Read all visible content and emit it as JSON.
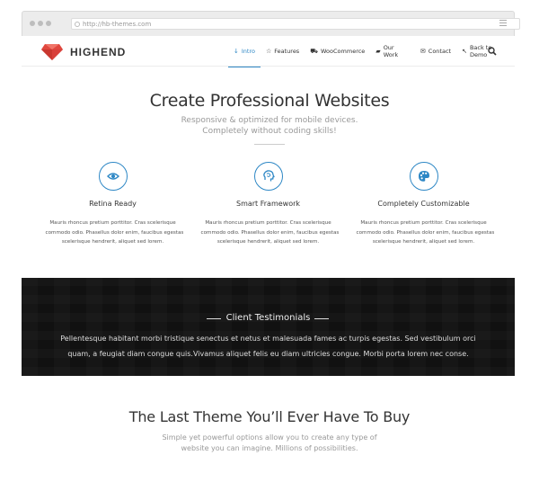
{
  "browser": {
    "url": "http://hb-themes.com"
  },
  "header": {
    "logo_text": "HIGHEND",
    "nav": [
      {
        "label": "Intro",
        "icon": "arrow-down-icon",
        "glyph": "↓",
        "active": true
      },
      {
        "label": "Features",
        "icon": "star-icon",
        "glyph": "☆",
        "active": false
      },
      {
        "label": "WooCommerce",
        "icon": "cart-icon",
        "glyph": "⛟",
        "active": false
      },
      {
        "label": "Our Work",
        "icon": "briefcase-icon",
        "glyph": "▰",
        "active": false
      },
      {
        "label": "Contact",
        "icon": "envelope-icon",
        "glyph": "✉",
        "active": false
      },
      {
        "label": "Back to Demo",
        "icon": "cursor-icon",
        "glyph": "↖",
        "active": false
      }
    ]
  },
  "hero": {
    "title": "Create Professional Websites",
    "subtitle_line1": "Responsive & optimized for mobile devices.",
    "subtitle_line2": "Completely without coding skills!"
  },
  "features": [
    {
      "title": "Retina Ready",
      "icon": "eye-icon",
      "lines": [
        "Mauris rhoncus pretium porttitor. Cras scelerisque",
        "commodo odio. Phasellus dolor enim, faucibus egestas",
        "scelerisque hendrerit, aliquet sed lorem."
      ]
    },
    {
      "title": "Smart Framework",
      "icon": "brain-icon",
      "lines": [
        "Mauris rhoncus pretium porttitor. Cras scelerisque",
        "commodo odio. Phasellus dolor enim, faucibus egestas",
        "scelerisque hendrerit, aliquet sed lorem."
      ]
    },
    {
      "title": "Completely Customizable",
      "icon": "palette-icon",
      "lines": [
        "Mauris rhoncus pretium porttitor. Cras scelerisque",
        "commodo odio. Phasellus dolor enim, faucibus egestas",
        "scelerisque hendrerit, aliquet sed lorem."
      ]
    }
  ],
  "testimonials": {
    "heading": "Client Testimonials",
    "line1": "Pellentesque habitant morbi tristique senectus et netus et malesuada fames ac turpis egestas. Sed vestibulum orci",
    "line2": "quam, a feugiat diam congue quis.Vivamus aliquet felis eu diam ultricies congue. Morbi porta lorem nec conse."
  },
  "bottom": {
    "title": "The Last Theme You’ll Ever Have To Buy",
    "line1": "Simple yet powerful options allow you to create any type of",
    "line2": "website you can imagine. Millions of possibilities."
  },
  "colors": {
    "accent": "#2d87c5",
    "logo_red": "#e0473e",
    "testimonials_bg": "#111111"
  }
}
